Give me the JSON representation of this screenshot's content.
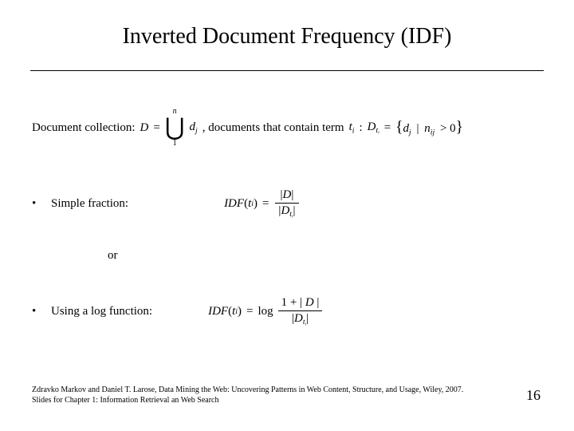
{
  "title": "Inverted Document Frequency (IDF)",
  "line1": {
    "label_collection": "Document collection:",
    "eq_D": "D",
    "eq_eq": "=",
    "union_top": "n",
    "union_bot": "1",
    "eq_dj_d": "d",
    "eq_dj_j": "j",
    "label_contain": ", documents that contain term",
    "eq_ti_t": "t",
    "eq_ti_i": "i",
    "colon": ":",
    "eq_Dti_D": "D",
    "eq_Dti_t": "t",
    "eq_Dti_i": "i",
    "eq_eq2": "=",
    "set_dj_d": "d",
    "set_dj_j": "j",
    "set_bar": "|",
    "set_nij_n": "n",
    "set_nij_ij": "ij",
    "set_gt0": "> 0"
  },
  "bullets": {
    "simple": "Simple fraction:",
    "or": "or",
    "log": "Using a log function:"
  },
  "formula_simple": {
    "lhs_IDF": "IDF",
    "lhs_t": "t",
    "lhs_i": "i",
    "eq": "=",
    "num_bar_l": "|",
    "num_D": "D",
    "num_bar_r": "|",
    "den_bar_l": "|",
    "den_D": "D",
    "den_t": "t",
    "den_i": "i",
    "den_bar_r": "|"
  },
  "formula_log": {
    "lhs_IDF": "IDF",
    "lhs_t": "t",
    "lhs_i": "i",
    "eq": "=",
    "log": "log",
    "num_1plus": "1 + |",
    "num_D": "D",
    "num_bar_r": "|",
    "den_bar_l": "|",
    "den_D": "D",
    "den_t": "t",
    "den_i": "i",
    "den_bar_r": "|"
  },
  "footer": {
    "line1": "Zdravko Markov and Daniel T. Larose, Data Mining the Web: Uncovering Patterns in Web Content, Structure, and Usage, Wiley, 2007.",
    "line2": "Slides for Chapter 1: Information Retrieval an Web Search"
  },
  "page": "16"
}
